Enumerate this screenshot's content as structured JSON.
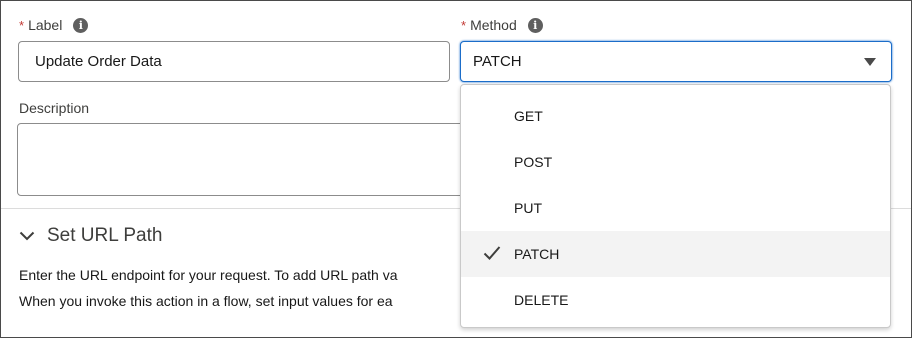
{
  "label_field": {
    "label": "Label",
    "required_mark": "*",
    "value": "Update Order Data"
  },
  "method_field": {
    "label": "Method",
    "required_mark": "*",
    "value": "PATCH"
  },
  "description_field": {
    "label": "Description",
    "value": ""
  },
  "section": {
    "title": "Set URL Path"
  },
  "body_lines": [
    "Enter the URL endpoint for your request. To add URL path va",
    "When you invoke this action in a flow, set input values for ea"
  ],
  "dropdown": {
    "options": [
      {
        "label": "GET",
        "selected": false
      },
      {
        "label": "POST",
        "selected": false
      },
      {
        "label": "PUT",
        "selected": false
      },
      {
        "label": "PATCH",
        "selected": true
      },
      {
        "label": "DELETE",
        "selected": false
      }
    ]
  },
  "colors": {
    "focus_border": "#1b6dc9",
    "required": "#c23934",
    "selected_row": "#f3f3f3"
  },
  "icons": {
    "info": "info-icon",
    "chevron": "chevron-down-icon",
    "caret": "caret-down-icon",
    "check": "check-icon"
  }
}
